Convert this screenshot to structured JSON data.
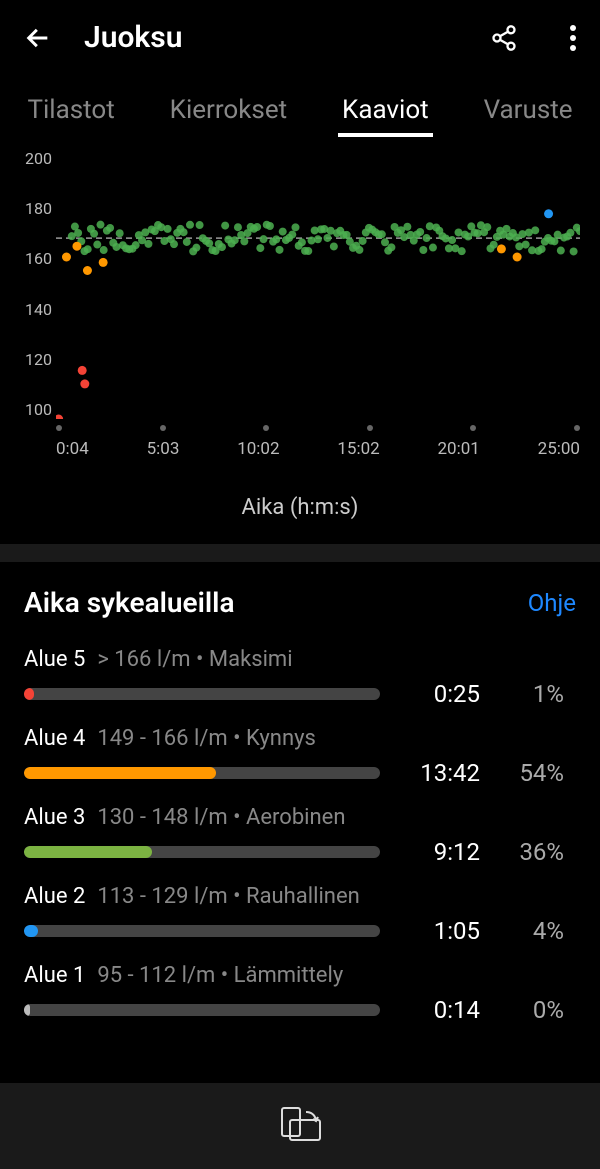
{
  "header": {
    "title": "Juoksu"
  },
  "tabs": [
    {
      "label": "Tilastot",
      "active": false
    },
    {
      "label": "Kierrokset",
      "active": false
    },
    {
      "label": "Kaaviot",
      "active": true
    },
    {
      "label": "Varuste",
      "active": false
    }
  ],
  "chart_data": {
    "type": "scatter",
    "title": "",
    "xlabel": "Aika (h:m:s)",
    "ylabel": "",
    "ylim": [
      100,
      200
    ],
    "x_ticks": [
      "0:04",
      "5:03",
      "10:02",
      "15:02",
      "20:01",
      "25:00"
    ],
    "y_ticks": [
      200,
      180,
      160,
      140,
      120,
      100
    ],
    "reference_line": 167,
    "series": [
      {
        "name": "heart_rate_green",
        "color": "#4caf50",
        "y_range": [
          162,
          172
        ],
        "x_range_pct": [
          3,
          100
        ],
        "density": "high"
      },
      {
        "name": "zone4_orange",
        "color": "#ff9800",
        "points_pct": [
          {
            "x": 2,
            "y": 160
          },
          {
            "x": 4,
            "y": 164
          },
          {
            "x": 6,
            "y": 155
          },
          {
            "x": 9,
            "y": 158
          },
          {
            "x": 85,
            "y": 163
          },
          {
            "x": 88,
            "y": 160
          }
        ]
      },
      {
        "name": "zone5_red",
        "color": "#f44336",
        "points_pct": [
          {
            "x": 0.5,
            "y": 100
          },
          {
            "x": 5,
            "y": 118
          },
          {
            "x": 5.5,
            "y": 113
          }
        ]
      },
      {
        "name": "zone2_blue",
        "color": "#2196f3",
        "points_pct": [
          {
            "x": 94,
            "y": 176
          }
        ]
      }
    ]
  },
  "zones_section": {
    "title": "Aika sykealueilla",
    "help": "Ohje"
  },
  "zones": [
    {
      "name": "Alue 5",
      "desc": "> 166 l/m • Maksimi",
      "pct": 1,
      "time": "0:25",
      "pct_label": "1%",
      "color": "#f44336",
      "min_w": 10
    },
    {
      "name": "Alue 4",
      "desc": "149 - 166 l/m • Kynnys",
      "pct": 54,
      "time": "13:42",
      "pct_label": "54%",
      "color": "#ff9800",
      "min_w": 0
    },
    {
      "name": "Alue 3",
      "desc": "130 - 148 l/m • Aerobinen",
      "pct": 36,
      "time": "9:12",
      "pct_label": "36%",
      "color": "#7cb342",
      "min_w": 0
    },
    {
      "name": "Alue 2",
      "desc": "113 - 129 l/m • Rauhallinen",
      "pct": 4,
      "time": "1:05",
      "pct_label": "4%",
      "color": "#2196f3",
      "min_w": 12
    },
    {
      "name": "Alue 1",
      "desc": "95 - 112 l/m • Lämmittely",
      "pct": 0,
      "time": "0:14",
      "pct_label": "0%",
      "color": "#bbb",
      "min_w": 6
    }
  ]
}
